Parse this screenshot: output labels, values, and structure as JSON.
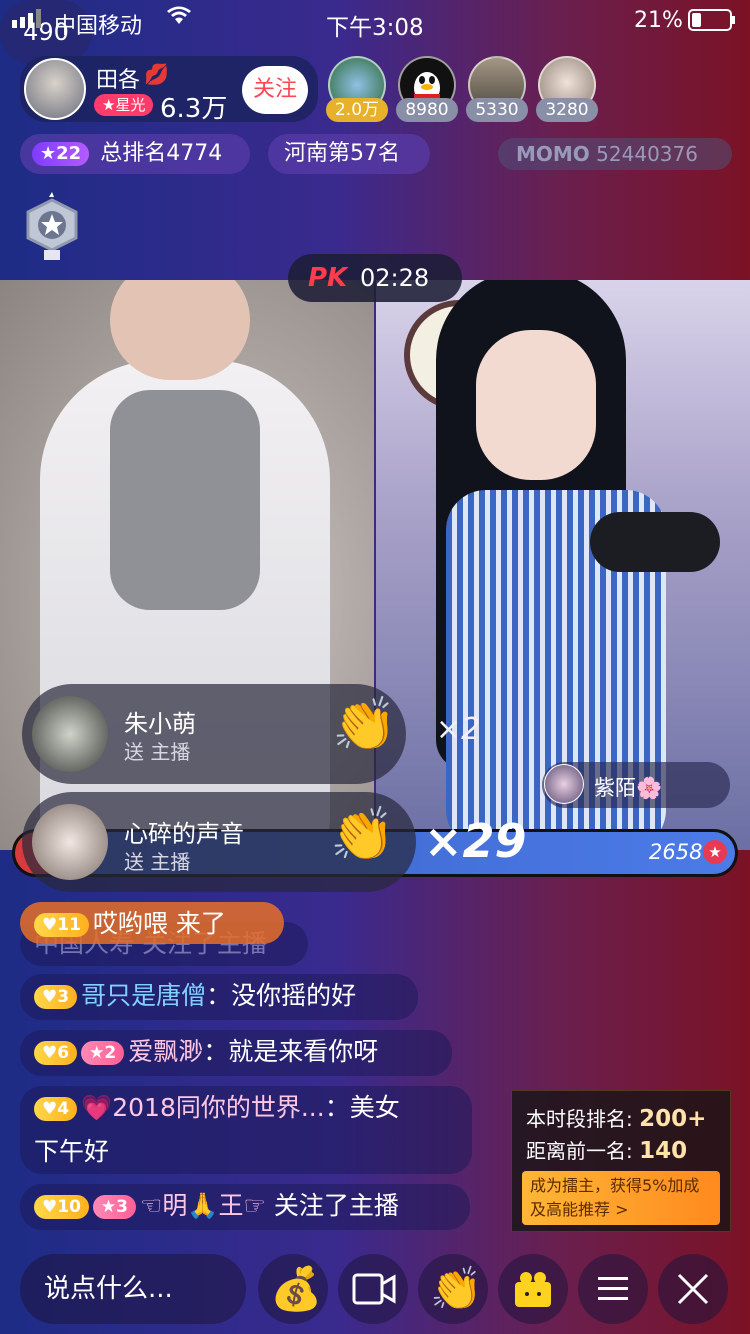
{
  "status_bar": {
    "carrier": "中国移动",
    "time": "下午3:08",
    "battery": "21%"
  },
  "anchor": {
    "name": "田各",
    "level_tag": "星光",
    "followers": "6.3万",
    "follow_label": "关注"
  },
  "viewers": [
    {
      "count": "2.0万",
      "color": "#e8b12c"
    },
    {
      "count": "8980",
      "color": "#8a8fa8"
    },
    {
      "count": "5330",
      "color": "#8a8fa8"
    },
    {
      "count": "3280",
      "color": "#8a8fa8"
    }
  ],
  "viewer_total": "490",
  "rank": {
    "level": "22",
    "total_rank": "总排名4774",
    "region_rank": "河南第57名",
    "momo_label": "MOMO",
    "momo_id": "52440376"
  },
  "pk": {
    "label": "PK",
    "timer": "02:28",
    "score_right": "2658"
  },
  "gifts": [
    {
      "sender": "朱小萌",
      "action": "送 主播",
      "multiplier": "×2"
    },
    {
      "sender": "心碎的声音",
      "action": "送 主播",
      "multiplier": "×29"
    }
  ],
  "opponent": {
    "name": "紫陌🌸"
  },
  "chat": [
    {
      "badge": "11",
      "text": "哎哟喂  来了"
    },
    {
      "ghost": "中国人寿 关注了主播"
    },
    {
      "badge": "3",
      "name": "哥只是唐僧",
      "sep": "：",
      "text": "没你摇的好"
    },
    {
      "badge": "6",
      "badge2": "2",
      "name": "爱飘渺",
      "sep": "：",
      "text": "就是来看你呀"
    },
    {
      "badge": "4",
      "name": "💗2018同你的世界...",
      "sep": "：",
      "text": "美女",
      "text2": "下午好"
    },
    {
      "badge": "10",
      "badge2": "3",
      "name": "☜明🙏王☞",
      "text": " 关注了主播"
    }
  ],
  "rank_card": {
    "line1_label": "本时段排名:",
    "line1_value": "200+",
    "line2_label": "距离前一名:",
    "line2_value": "140",
    "promo": "成为擂主，获得5%加成及高能推荐 >"
  },
  "input": {
    "placeholder": "说点什么..."
  },
  "bottom_icons": [
    "fortune-bag-icon",
    "video-camera-icon",
    "clap-icon",
    "gift-box-icon",
    "menu-icon",
    "close-icon"
  ]
}
